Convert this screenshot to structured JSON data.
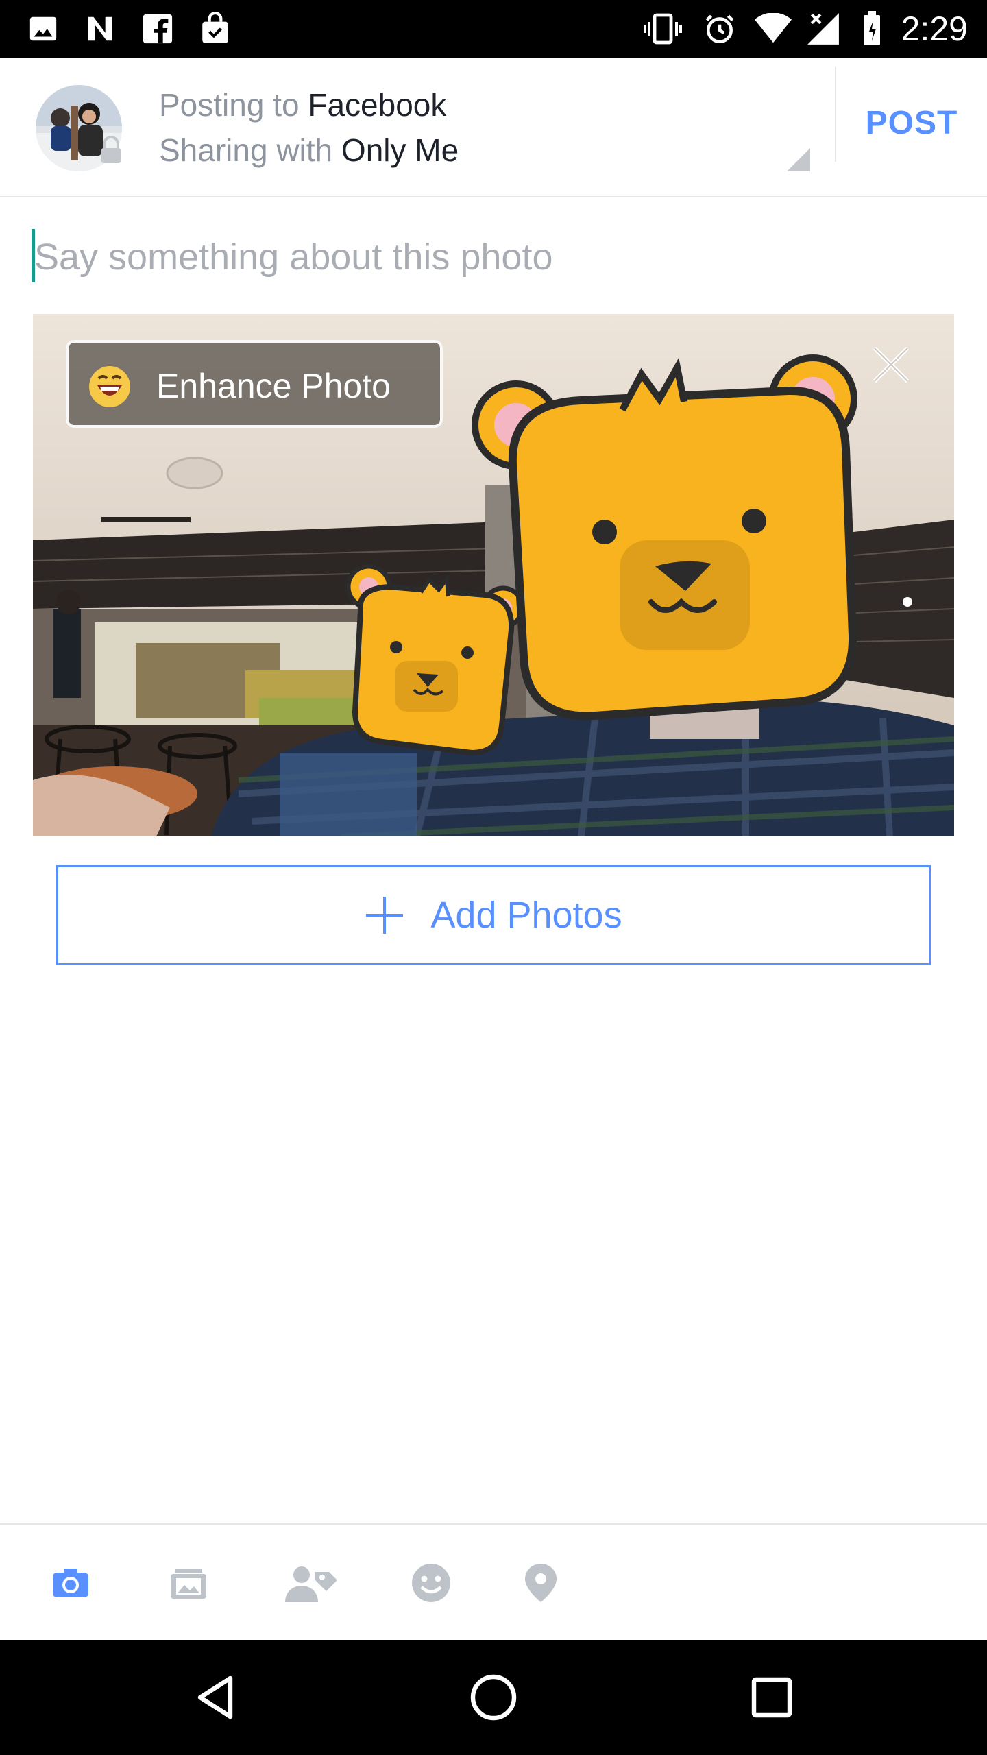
{
  "status_bar": {
    "time": "2:29",
    "left_icons": [
      "image-icon",
      "nyt-icon",
      "facebook-icon",
      "shopping-bag-icon"
    ],
    "right_icons": [
      "vibrate-icon",
      "alarm-icon",
      "wifi-icon",
      "signal-icon",
      "battery-icon"
    ]
  },
  "header": {
    "posting_prefix": "Posting to",
    "posting_target": "Facebook",
    "sharing_prefix": "Sharing with",
    "sharing_audience": "Only Me",
    "post_label": "POST"
  },
  "composer": {
    "placeholder": "Say something about this photo"
  },
  "photo": {
    "enhance_label": "Enhance Photo"
  },
  "add_photos": {
    "label": "Add Photos"
  },
  "toolbar": {
    "items": [
      "camera-icon",
      "photo-gallery-icon",
      "tag-people-icon",
      "emoji-icon",
      "location-pin-icon"
    ],
    "active_item": "camera-icon"
  },
  "colors": {
    "accent": "#5890ff",
    "muted_text": "#8d949e",
    "caret": "#1a9b8e"
  }
}
